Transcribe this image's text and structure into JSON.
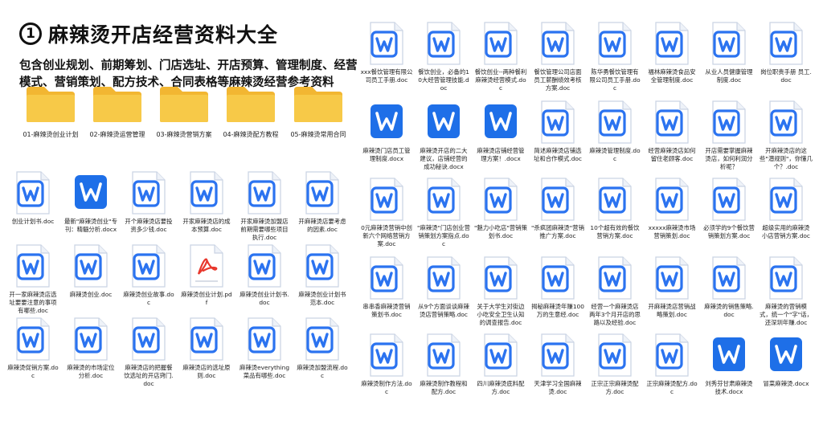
{
  "header": {
    "number": "1",
    "title": "麻辣烫开店经营资料大全",
    "subtitle_line1": "包含创业规划、前期筹划、门店选址、开店预算、管理制度、经营",
    "subtitle_line2": "模式、营销策划、配方技术、合同表格等麻辣烫经营参考资料"
  },
  "colors": {
    "word_blue": "#2b73f0",
    "word_solid_blue": "#1e6fe8",
    "folder_yellow": "#f7c948",
    "pdf_red": "#e8372c"
  },
  "folders": [
    {
      "label": "01-麻辣烫创业计划"
    },
    {
      "label": "02-麻辣烫运营管理"
    },
    {
      "label": "03-麻辣烫营销方案"
    },
    {
      "label": "04-麻辣烫配方教程"
    },
    {
      "label": "05-麻辣烫常用合同"
    }
  ],
  "left_files": [
    {
      "label": "创业计划书.doc",
      "icon": "word-outline-icon"
    },
    {
      "label": "最新\"麻辣烫创业\"专刊：精髓分析.docx",
      "icon": "word-solid-icon"
    },
    {
      "label": "开个麻辣烫店要投资多少钱.doc",
      "icon": "word-outline-icon"
    },
    {
      "label": "开家麻辣烫店的成本预算.doc",
      "icon": "word-outline-icon"
    },
    {
      "label": "开家麻辣烫加盟店前期需要哪些项目执行.doc",
      "icon": "word-outline-icon"
    },
    {
      "label": "开麻辣烫店要考虑的因素.doc",
      "icon": "word-outline-icon"
    },
    {
      "label": "开一家麻辣烫店选址要要注意的事项有哪些.doc",
      "icon": "word-outline-icon"
    },
    {
      "label": "麻辣烫创业.doc",
      "icon": "word-outline-icon"
    },
    {
      "label": "麻辣烫创业故事.doc",
      "icon": "word-outline-icon"
    },
    {
      "label": "麻辣烫创业计划.pdf",
      "icon": "pdf-icon"
    },
    {
      "label": "麻辣烫创业计划书.doc",
      "icon": "word-outline-icon"
    },
    {
      "label": "麻辣烫创业计划书范本.doc",
      "icon": "word-outline-icon"
    },
    {
      "label": "麻辣烫促销方案.doc",
      "icon": "word-outline-icon"
    },
    {
      "label": "麻辣烫的市场定位分析.doc",
      "icon": "word-outline-icon"
    },
    {
      "label": "麻辣烫店的把握餐饮选址的开店窍门.doc",
      "icon": "word-outline-icon"
    },
    {
      "label": "麻辣烫店的选址原则.doc",
      "icon": "word-outline-icon"
    },
    {
      "label": "麻辣烫everything菜品有哪些.doc",
      "icon": "word-outline-icon"
    },
    {
      "label": "麻辣烫加盟流程.doc",
      "icon": "word-outline-icon"
    }
  ],
  "right_files": [
    {
      "label": "xxx餐饮管理有限公司员工手册.doc",
      "icon": "word-outline-icon"
    },
    {
      "label": "餐饮创业，必备的10大经营管理技能.doc",
      "icon": "word-outline-icon"
    },
    {
      "label": "餐饮创业--两种餐利麻辣烫经营模式.doc",
      "icon": "word-outline-icon"
    },
    {
      "label": "餐饮管理公司店面员工薪酬绩效考核方案.doc",
      "icon": "word-outline-icon"
    },
    {
      "label": "陈华勇餐饮管理有限公司员工手册.doc",
      "icon": "word-outline-icon"
    },
    {
      "label": "福林麻辣烫食品安全管理制度.doc",
      "icon": "word-outline-icon"
    },
    {
      "label": "从业人员健康管理制度.doc",
      "icon": "word-outline-icon"
    },
    {
      "label": "岗位职责手册 员工.doc",
      "icon": "word-outline-icon"
    },
    {
      "label": "麻辣烫门店员工管理制度.docx",
      "icon": "word-solid-icon"
    },
    {
      "label": "麻辣烫开店的二大建议，店铺经营的成功秘诀.docx",
      "icon": "word-solid-icon"
    },
    {
      "label": "麻辣烫店铺经营管理方案！.docx",
      "icon": "word-solid-icon"
    },
    {
      "label": "简述麻辣烫店铺选址和合作模式.doc",
      "icon": "word-outline-icon"
    },
    {
      "label": "麻辣烫管理制度.doc",
      "icon": "word-outline-icon"
    },
    {
      "label": "经营麻辣烫店如何留住老顾客.doc",
      "icon": "word-outline-icon"
    },
    {
      "label": "开店需要掌握麻辣烫店，如何利润分析呢？",
      "icon": "word-outline-icon"
    },
    {
      "label": "开麻辣烫店的这些\"潜规则\"，你懂几个？.doc",
      "icon": "word-outline-icon"
    },
    {
      "label": "0元麻辣烫营销中创新六个网络营销方案.doc",
      "icon": "word-outline-icon"
    },
    {
      "label": "\"麻辣烫\"门店创业营销策划方案指点.doc",
      "icon": "word-outline-icon"
    },
    {
      "label": "\"魅力小吃店\"营销策划书.doc",
      "icon": "word-outline-icon"
    },
    {
      "label": "\"杀疯团麻辣烫\"营销推广方案.doc",
      "icon": "word-outline-icon"
    },
    {
      "label": "10个超有效的餐饮营销方案.doc",
      "icon": "word-outline-icon"
    },
    {
      "label": "xxxxx麻辣烫市场营销策划.doc",
      "icon": "word-outline-icon"
    },
    {
      "label": "必须学的9个餐饮营销策划方案.doc",
      "icon": "word-outline-icon"
    },
    {
      "label": "超级实用的麻辣烫小店营销方案.doc",
      "icon": "word-outline-icon"
    },
    {
      "label": "串串香麻辣烫营销策划书.doc",
      "icon": "word-outline-icon"
    },
    {
      "label": "从9个方面谈谈麻辣烫店营销策略.doc",
      "icon": "word-outline-icon"
    },
    {
      "label": "关于大学生对街边小吃安全卫生认知的调查报告.doc",
      "icon": "word-outline-icon"
    },
    {
      "label": "揭秘麻辣烫年赚100万的生意经.doc",
      "icon": "word-outline-icon"
    },
    {
      "label": "经营一个麻辣烫店两年3个月开店的思路以及经验.doc",
      "icon": "word-outline-icon"
    },
    {
      "label": "开麻辣烫店营销战略策划.doc",
      "icon": "word-outline-icon"
    },
    {
      "label": "麻辣烫的销售策略.doc",
      "icon": "word-outline-icon"
    },
    {
      "label": "麻辣烫的营销模式，统一个\"字\"话，还深圳年赚.doc",
      "icon": "word-outline-icon"
    },
    {
      "label": "麻辣烫制作方法.doc",
      "icon": "word-outline-icon"
    },
    {
      "label": "麻辣烫制作教程和配方.doc",
      "icon": "word-outline-icon"
    },
    {
      "label": "四川麻辣烫底料配方.doc",
      "icon": "word-outline-icon"
    },
    {
      "label": "天津学习全国麻辣烫.doc",
      "icon": "word-outline-icon"
    },
    {
      "label": "正宗正宗麻辣烫配方.doc",
      "icon": "word-outline-icon"
    },
    {
      "label": "正宗麻辣烫配方.doc",
      "icon": "word-outline-icon"
    },
    {
      "label": "刘秀芬甘肃麻辣烫技术.docx",
      "icon": "word-solid-icon"
    },
    {
      "label": "冒菜麻辣烫.docx",
      "icon": "word-solid-icon"
    }
  ]
}
